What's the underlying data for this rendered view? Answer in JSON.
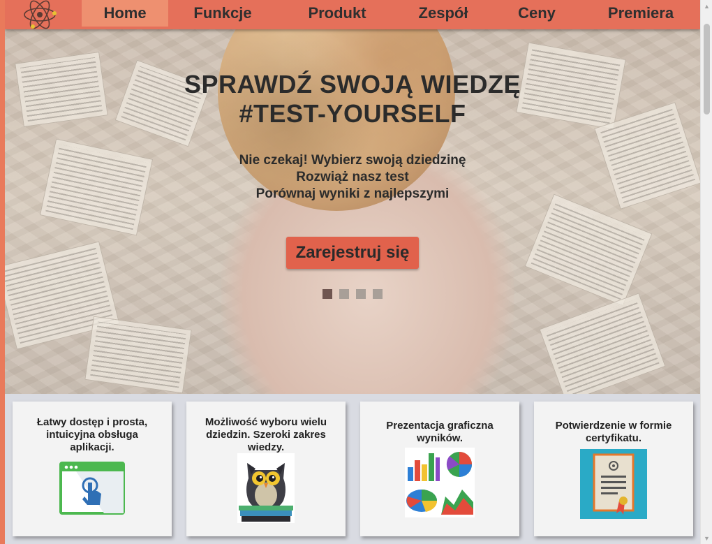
{
  "nav": {
    "items": [
      {
        "label": "Home",
        "active": true
      },
      {
        "label": "Funkcje",
        "active": false
      },
      {
        "label": "Produkt",
        "active": false
      },
      {
        "label": "Zespół",
        "active": false
      },
      {
        "label": "Ceny",
        "active": false
      },
      {
        "label": "Premiera",
        "active": false
      }
    ]
  },
  "hero": {
    "title_line1": "SPRAWDŹ SWOJĄ WIEDZĘ",
    "title_line2": "#TEST-YOURSELF",
    "text_line1": "Nie czekaj! Wybierz swoją dziedzinę",
    "text_line2": "Rozwiąż nasz test",
    "text_line3": "Porównaj wyniki z najlepszymi",
    "button_label": "Zarejestruj się",
    "slides_total": 4,
    "active_slide": 1
  },
  "features": [
    {
      "text": "Łatwy dostęp i prosta, intuicyjna obsługa aplikacji.",
      "icon": "browser-click-icon"
    },
    {
      "text": "Możliwość wyboru wielu dziedzin. Szeroki zakres wiedzy.",
      "icon": "owl-books-icon"
    },
    {
      "text": "Prezentacja graficzna wyników.",
      "icon": "charts-icon"
    },
    {
      "text": "Potwierdzenie w formie certyfikatu.",
      "icon": "certificate-icon"
    }
  ],
  "colors": {
    "primary": "#e5705a",
    "nav_active": "#ee9070",
    "button": "#e1624c"
  }
}
